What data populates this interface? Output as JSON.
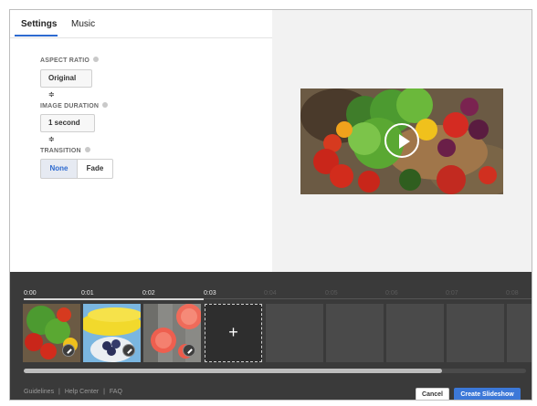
{
  "tabs": [
    {
      "label": "Settings",
      "active": true
    },
    {
      "label": "Music",
      "active": false
    }
  ],
  "settings": {
    "aspect_ratio": {
      "label": "ASPECT RATIO",
      "value": "Original ≑"
    },
    "image_duration": {
      "label": "IMAGE DURATION",
      "value": "1 second ≑"
    },
    "transition": {
      "label": "TRANSITION",
      "options": [
        "None",
        "Fade"
      ],
      "selected": "None"
    }
  },
  "timeline": {
    "ticks": [
      "0:00",
      "0:01",
      "0:02",
      "0:03",
      "0:04",
      "0:05",
      "0:06",
      "0:07",
      "0:08"
    ],
    "add_label": "+"
  },
  "footer": {
    "links": [
      "Guidelines",
      "Help Center",
      "FAQ"
    ],
    "separator": "|",
    "cancel_label": "Cancel",
    "create_label": "Create Slideshow"
  },
  "colors": {
    "accent": "#3c78d8",
    "timeline_bg": "#3a3a3a",
    "preview_bg": "#f2f2f2"
  }
}
